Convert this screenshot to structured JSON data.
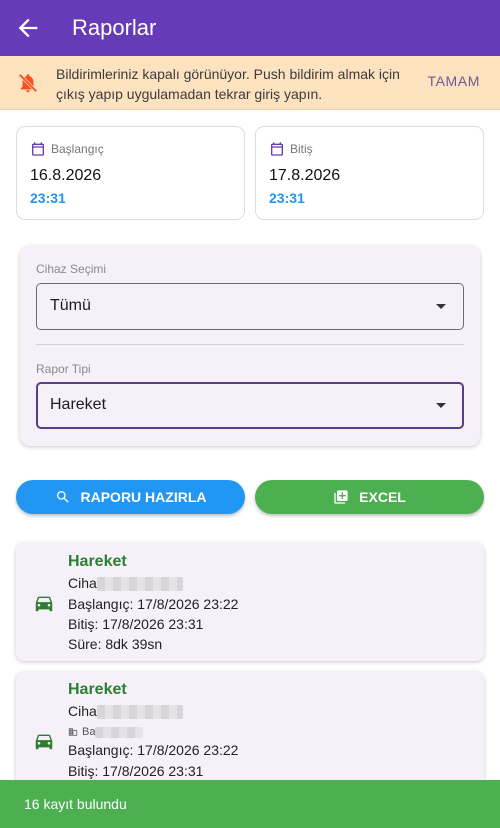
{
  "app_bar": {
    "title": "Raporlar"
  },
  "notice": {
    "message": "Bildirimleriniz kapalı görünüyor. Push bildirim almak için çıkış yapıp uygulamadan tekrar giriş yapın.",
    "action_label": "TAMAM"
  },
  "date_range": {
    "start": {
      "label": "Başlangıç",
      "date": "16.8.2026",
      "time": "23:31"
    },
    "end": {
      "label": "Bitiş",
      "date": "17.8.2026",
      "time": "23:31"
    }
  },
  "filters": {
    "device": {
      "label": "Cihaz Seçimi",
      "value": "Tümü"
    },
    "report_type": {
      "label": "Rapor Tipi",
      "value": "Hareket"
    }
  },
  "actions": {
    "prepare_label": "RAPORU HAZIRLA",
    "excel_label": "EXCEL"
  },
  "reports": [
    {
      "title": "Hareket",
      "device_prefix": "Ciha",
      "start": "Başlangıç: 17/8/2026 23:22",
      "end": "Bitiş: 17/8/2026 23:31",
      "duration": "Süre: 8dk 39sn"
    },
    {
      "title": "Hareket",
      "device_prefix": "Ciha",
      "location_prefix": "Ba",
      "start": "Başlangıç: 17/8/2026 23:22",
      "end": "Bitiş: 17/8/2026 23:31"
    }
  ],
  "footer": {
    "count_text": "16 kayıt bulundu"
  },
  "colors": {
    "primary": "#673ab7",
    "banner_bg": "#fde2c0",
    "accent_blue": "#2196f3",
    "excel_green": "#4caf50",
    "report_title_green": "#2e7d32",
    "warning_orange": "#f4511e"
  },
  "icons": {
    "back": "arrow-left-icon",
    "notification": "bell-off-icon",
    "date": "calendar-icon",
    "dropdown": "caret-down-icon",
    "prepare": "search-icon",
    "excel": "spreadsheet-icon",
    "report": "car-icon",
    "location": "building-icon"
  }
}
